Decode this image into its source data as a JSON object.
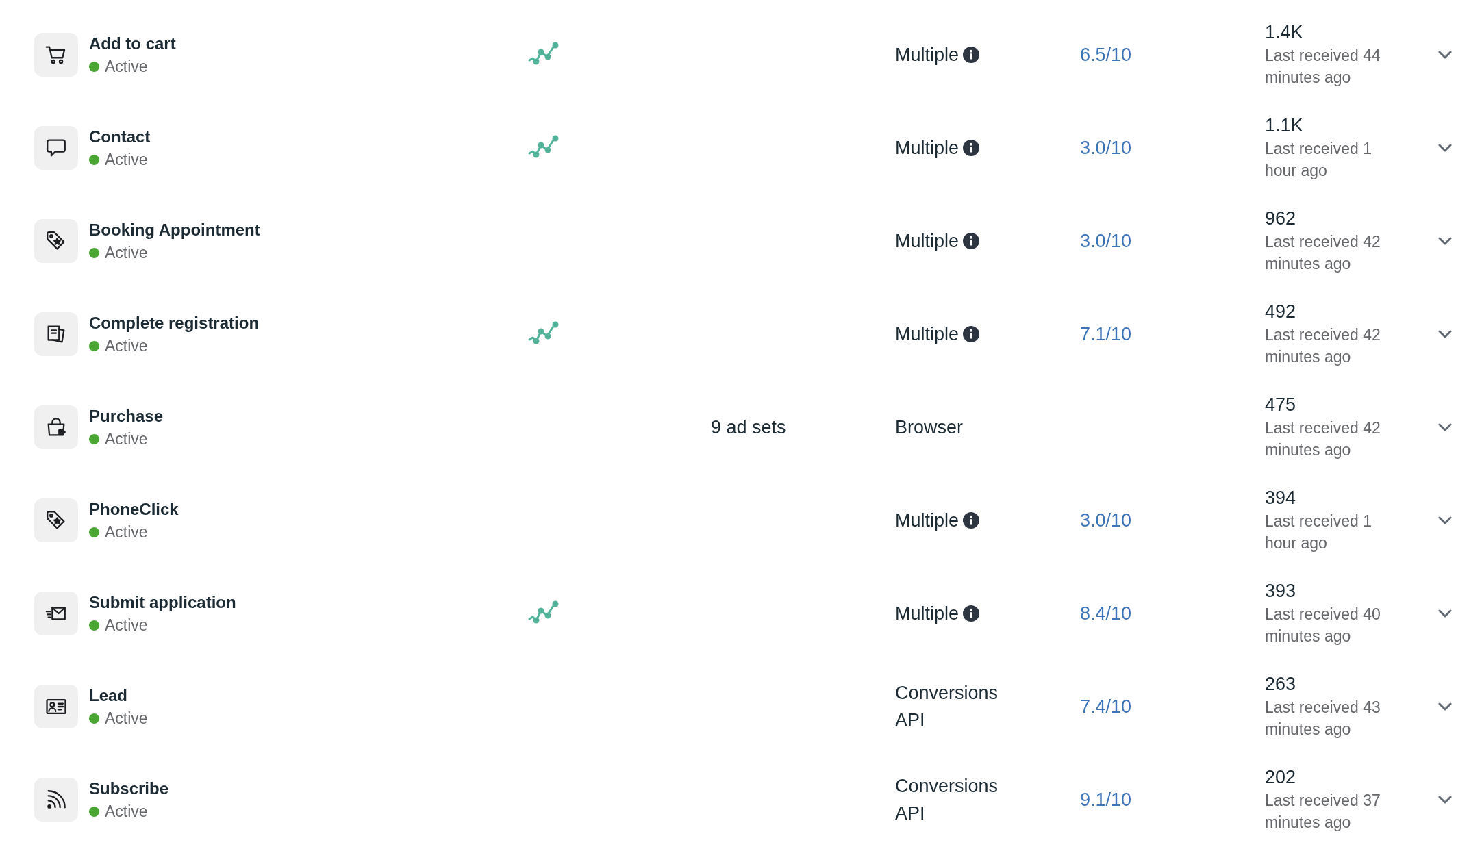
{
  "events": [
    {
      "kind": "cart",
      "name": "Add to cart",
      "status": "Active",
      "trend": true,
      "integration": "Multiple",
      "info": true,
      "quality": "6.5/10",
      "count": "1.4K",
      "last_received": "Last received 44 minutes ago"
    },
    {
      "kind": "chat",
      "name": "Contact",
      "status": "Active",
      "trend": true,
      "integration": "Multiple",
      "info": true,
      "quality": "3.0/10",
      "count": "1.1K",
      "last_received": "Last received 1 hour ago"
    },
    {
      "kind": "tag",
      "name": "Booking Appointment",
      "status": "Active",
      "trend": false,
      "integration": "Multiple",
      "info": true,
      "quality": "3.0/10",
      "count": "962",
      "last_received": "Last received 42 minutes ago"
    },
    {
      "kind": "documents",
      "name": "Complete registration",
      "status": "Active",
      "trend": true,
      "integration": "Multiple",
      "info": true,
      "quality": "7.1/10",
      "count": "492",
      "last_received": "Last received 42 minutes ago"
    },
    {
      "kind": "bag",
      "name": "Purchase",
      "status": "Active",
      "trend": false,
      "ad_sets": "9 ad sets",
      "integration": "Browser",
      "info": false,
      "count": "475",
      "last_received": "Last received 42 minutes ago"
    },
    {
      "kind": "tag",
      "name": "PhoneClick",
      "status": "Active",
      "trend": false,
      "integration": "Multiple",
      "info": true,
      "quality": "3.0/10",
      "count": "394",
      "last_received": "Last received 1 hour ago"
    },
    {
      "kind": "envelope",
      "name": "Submit application",
      "status": "Active",
      "trend": true,
      "integration": "Multiple",
      "info": true,
      "quality": "8.4/10",
      "count": "393",
      "last_received": "Last received 40 minutes ago"
    },
    {
      "kind": "idcard",
      "name": "Lead",
      "status": "Active",
      "trend": false,
      "integration": "Conversions API",
      "info": false,
      "quality": "7.4/10",
      "count": "263",
      "last_received": "Last received 43 minutes ago"
    },
    {
      "kind": "rss",
      "name": "Subscribe",
      "status": "Active",
      "trend": false,
      "integration": "Conversions API",
      "info": false,
      "quality": "9.1/10",
      "count": "202",
      "last_received": "Last received 37 minutes ago"
    }
  ]
}
